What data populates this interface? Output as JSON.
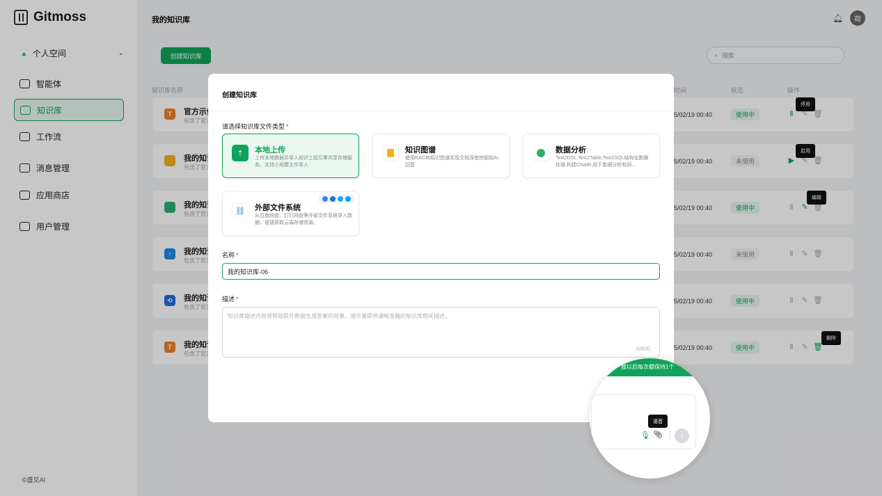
{
  "app": {
    "name": "Gitmoss",
    "footer": "©盛见AI"
  },
  "sidebar": {
    "workspace": "个人空间",
    "items": [
      {
        "label": "智能体",
        "icon": "agent-icon"
      },
      {
        "label": "知识库",
        "icon": "book-icon",
        "active": true
      },
      {
        "label": "工作流",
        "icon": "workflow-icon"
      },
      {
        "label": "消息管理",
        "icon": "message-icon"
      },
      {
        "label": "应用商店",
        "icon": "store-icon"
      },
      {
        "label": "用户管理",
        "icon": "users-icon"
      }
    ]
  },
  "header": {
    "title": "我的知识库",
    "avatar_text": "荷"
  },
  "toolbar": {
    "create_label": "创建知识库",
    "search_placeholder": "搜索"
  },
  "table": {
    "headers": {
      "name": "知识库名称",
      "time": "时间",
      "status": "状态",
      "ops": "操作"
    },
    "rows": [
      {
        "name": "官方示例",
        "desc": "包含了官方",
        "time": "5/02/19 00:40",
        "status": "使用中",
        "active": true,
        "icon_text": "T",
        "icon_color": "#e8812c"
      },
      {
        "name": "我的知识",
        "desc": "包含了官方",
        "time": "5/02/19 00:40",
        "status": "未使用",
        "active": false,
        "icon_text": "",
        "icon_color": "#f2b01e"
      },
      {
        "name": "我的知识",
        "desc": "包含了官方",
        "time": "5/02/19 00:40",
        "status": "使用中",
        "active": true,
        "icon_text": "",
        "icon_color": "#2bb06f"
      },
      {
        "name": "我的知识",
        "desc": "包含了官方",
        "time": "5/02/19 00:40",
        "status": "未使用",
        "active": false,
        "icon_text": "↑",
        "icon_color": "#1e88e5"
      },
      {
        "name": "我的知识",
        "desc": "包含了官方",
        "time": "5/02/19 00:40",
        "status": "使用中",
        "active": true,
        "icon_text": "⟲",
        "icon_color": "#1f6fe0"
      },
      {
        "name": "我的知识",
        "desc": "包含了官方",
        "time": "5/02/19 00:40",
        "status": "使用中",
        "active": true,
        "icon_text": "T",
        "icon_color": "#e8812c"
      }
    ],
    "tooltips": {
      "stop": "停用",
      "enable": "启用",
      "edit": "编辑",
      "delete": "删除"
    }
  },
  "modal": {
    "title": "创建知识库",
    "type_label": "请选择知识库文件类型",
    "types": [
      {
        "title": "本地上传",
        "desc": "上传本地数据并导入知识工程引擎共享存储服务。支持小规模文件导入",
        "color": "#10a35a",
        "icon": "upload-icon"
      },
      {
        "title": "知识图谱",
        "desc": "使用RAG和知识图谱实现文档深度挖掘和AI回复",
        "color": "#f2b01e",
        "icon": "graph-icon"
      },
      {
        "title": "数据分析",
        "desc": "Text2DSL,Text2Table,Text2SQL结构化数据处理,构建ChatBI,用于数据分析和洞...",
        "color": "#2bb06f",
        "icon": "chart-icon"
      },
      {
        "title": "外部文件系统",
        "desc": "从百度网盘、钉钉网盘等外部文件系统导入数据。便捷获取云端存储资源。",
        "color": "#1f6fe0",
        "icon": "link-icon"
      }
    ],
    "name_label": "名称",
    "name_value": "我的知识库-06",
    "desc_label": "描述",
    "desc_placeholder": "知识库描述内容将帮助提升数据生成答案的效果，请尽量提供清晰准确的知识库相关描述。",
    "counter": "0/600"
  },
  "magnifier": {
    "banner": "我以后每次都保持1个",
    "voice_tip": "语音"
  }
}
